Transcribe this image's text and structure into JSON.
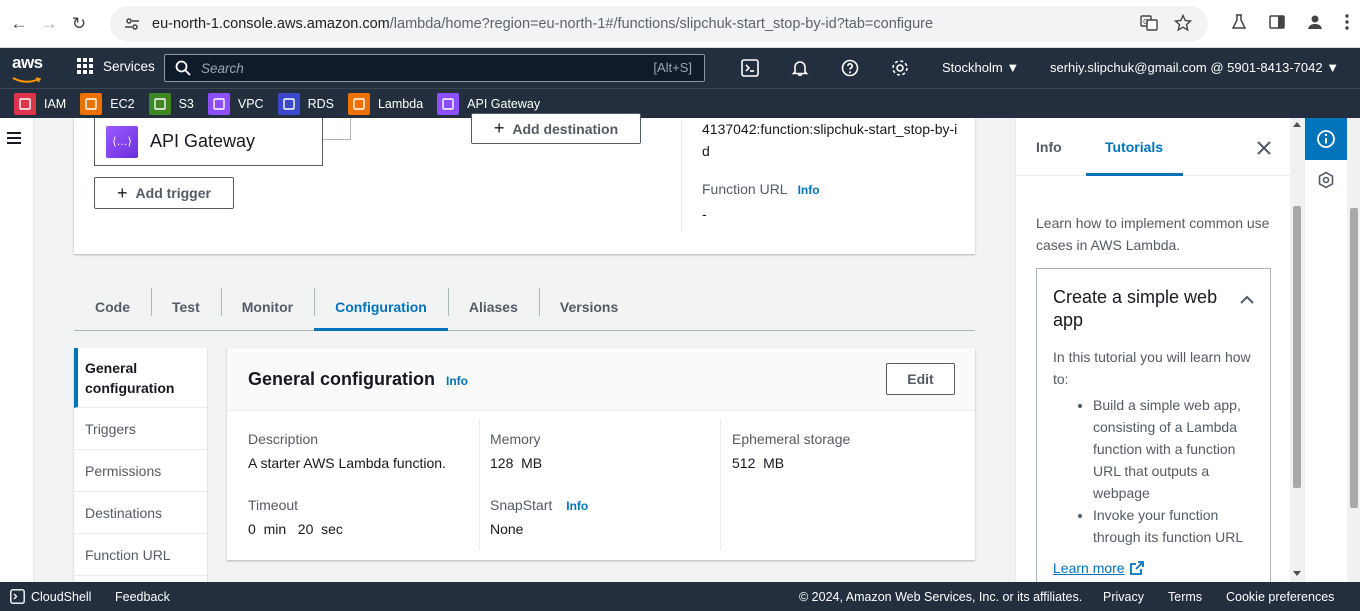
{
  "browser": {
    "url_host": "eu-north-1.console.aws.amazon.com",
    "url_path": "/lambda/home?region=eu-north-1#/functions/slipchuk-start_stop-by-id?tab=configure"
  },
  "awsnav": {
    "logo_text": "aws",
    "services_label": "Services",
    "search_placeholder": "Search",
    "search_shortcut": "[Alt+S]",
    "region": "Stockholm",
    "account": "serhiy.slipchuk@gmail.com @ 5901-8413-7042"
  },
  "favorites": [
    {
      "label": "IAM",
      "color": "#dd344c",
      "icon": "iam-icon"
    },
    {
      "label": "EC2",
      "color": "#ed7100",
      "icon": "ec2-icon"
    },
    {
      "label": "S3",
      "color": "#3f8624",
      "icon": "s3-icon"
    },
    {
      "label": "VPC",
      "color": "#8c4fff",
      "icon": "vpc-icon"
    },
    {
      "label": "RDS",
      "color": "#3b48cc",
      "icon": "rds-icon"
    },
    {
      "label": "Lambda",
      "color": "#ed7100",
      "icon": "lambda-icon"
    },
    {
      "label": "API Gateway",
      "color": "#8c4fff",
      "icon": "api-gateway-icon"
    }
  ],
  "diagram": {
    "trigger_name": "API Gateway",
    "add_trigger": "Add trigger",
    "add_destination": "Add destination",
    "function_arn": "4137042:function:slipchuk-start_stop-by-id",
    "function_url_label": "Function URL",
    "function_url_info": "Info",
    "function_url_value": "-"
  },
  "tabs": [
    {
      "label": "Code",
      "active": false
    },
    {
      "label": "Test",
      "active": false
    },
    {
      "label": "Monitor",
      "active": false
    },
    {
      "label": "Configuration",
      "active": true
    },
    {
      "label": "Aliases",
      "active": false
    },
    {
      "label": "Versions",
      "active": false
    }
  ],
  "config_nav": [
    {
      "label": "General configuration",
      "active": true
    },
    {
      "label": "Triggers",
      "active": false
    },
    {
      "label": "Permissions",
      "active": false
    },
    {
      "label": "Destinations",
      "active": false
    },
    {
      "label": "Function URL",
      "active": false
    }
  ],
  "general": {
    "title": "General configuration",
    "info": "Info",
    "edit": "Edit",
    "description_label": "Description",
    "description_value": "A starter AWS Lambda function.",
    "memory_label": "Memory",
    "memory_value": "128  MB",
    "ephemeral_label": "Ephemeral storage",
    "ephemeral_value": "512  MB",
    "timeout_label": "Timeout",
    "timeout_value": "0  min   20  sec",
    "snapstart_label": "SnapStart",
    "snapstart_info": "Info",
    "snapstart_value": "None"
  },
  "help_panel": {
    "tab_info": "Info",
    "tab_tutorials": "Tutorials",
    "intro": "Learn how to implement common use cases in AWS Lambda.",
    "tutorial_title": "Create a simple web app",
    "tutorial_lead": "In this tutorial you will learn how to:",
    "bullets": [
      "Build a simple web app, consisting of a Lambda function with a function URL that outputs a webpage",
      "Invoke your function through its function URL"
    ],
    "learn_more": "Learn more"
  },
  "footer": {
    "cloudshell": "CloudShell",
    "feedback": "Feedback",
    "copyright": "© 2024, Amazon Web Services, Inc. or its affiliates.",
    "privacy": "Privacy",
    "terms": "Terms",
    "cookies": "Cookie preferences"
  },
  "colors": {
    "aws_nav": "#232f3e",
    "link_blue": "#0073bb",
    "aws_orange": "#ff9900"
  }
}
